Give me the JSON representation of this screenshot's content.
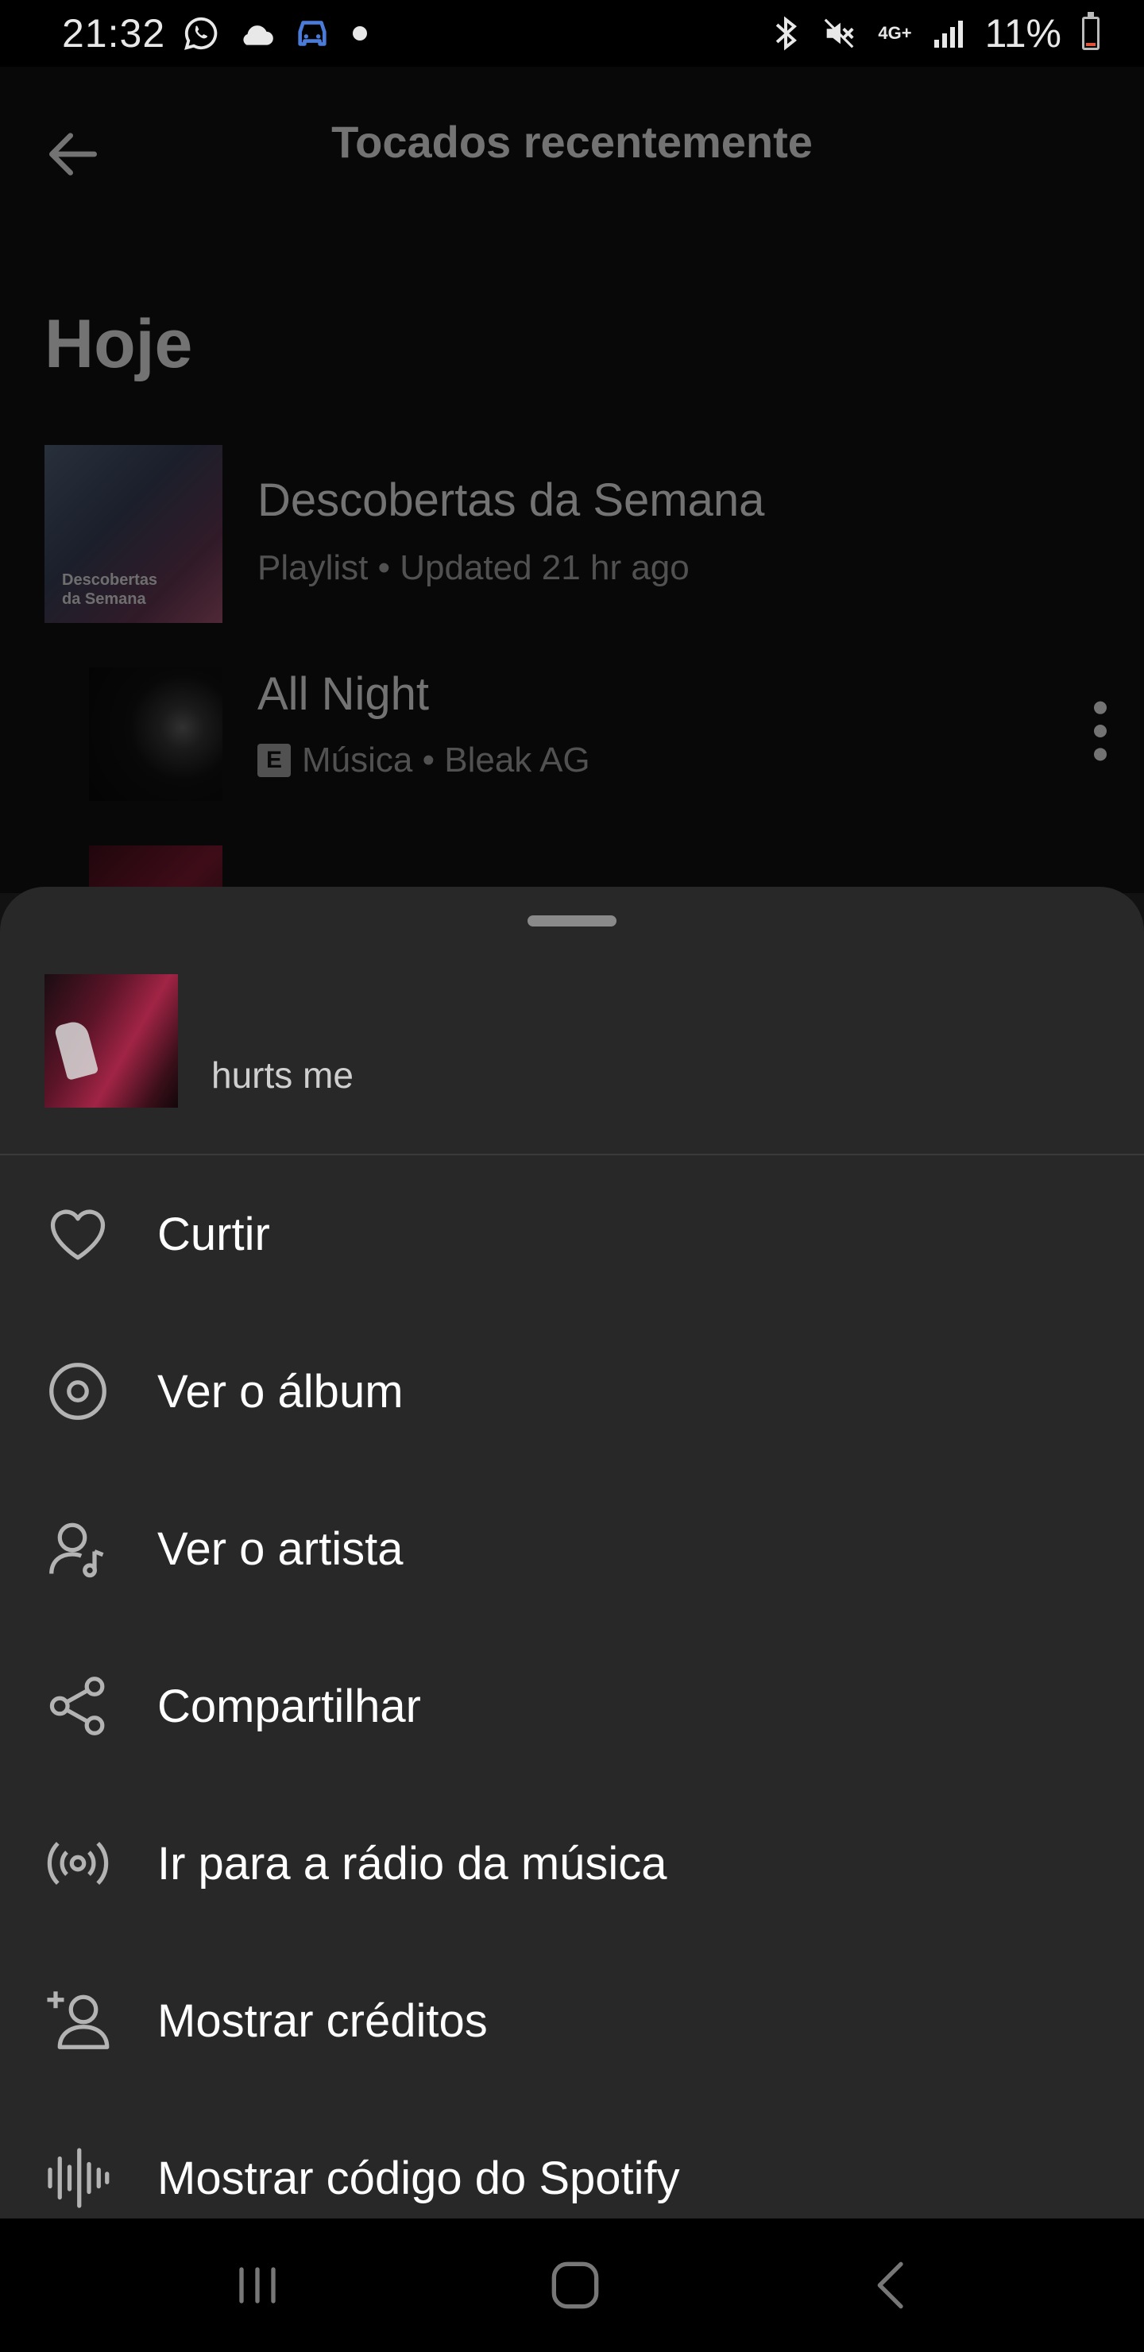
{
  "status_bar": {
    "time": "21:32",
    "network": "4G+",
    "battery": "11%",
    "icons": [
      "whatsapp-icon",
      "cloud-icon",
      "car-icon",
      "dot-icon",
      "bluetooth-icon",
      "mute-icon",
      "signal-icon",
      "battery-icon"
    ],
    "battery_level": 0.11
  },
  "header": {
    "title": "Tocados recentemente"
  },
  "section": {
    "title": "Hoje"
  },
  "recent_items": [
    {
      "title": "Descobertas da Semana",
      "subtitle": "Playlist • Updated 21 hr ago",
      "art_caption_line1": "Descobertas",
      "art_caption_line2": "da Semana"
    },
    {
      "title": "All Night",
      "explicit": "E",
      "subtitle": "Música • Bleak AG"
    }
  ],
  "sheet": {
    "track_title": "hurts me",
    "menu": [
      {
        "label": "Curtir",
        "icon": "heart-icon"
      },
      {
        "label": "Ver o álbum",
        "icon": "album-icon"
      },
      {
        "label": "Ver o artista",
        "icon": "artist-icon"
      },
      {
        "label": "Compartilhar",
        "icon": "share-icon"
      },
      {
        "label": "Ir para a rádio da música",
        "icon": "radio-icon"
      },
      {
        "label": "Mostrar créditos",
        "icon": "credits-icon"
      },
      {
        "label": "Mostrar código do Spotify",
        "icon": "spotify-code-icon"
      }
    ]
  },
  "nav_bar": {
    "buttons": [
      "recent-apps-icon",
      "home-icon",
      "back-nav-icon"
    ]
  },
  "colors": {
    "background": "#121212",
    "sheet": "#282828",
    "text_primary": "#ffffff",
    "text_secondary": "#b3b3b3",
    "car_icon": "#4a7bd8",
    "battery_low": "#e2543a"
  }
}
